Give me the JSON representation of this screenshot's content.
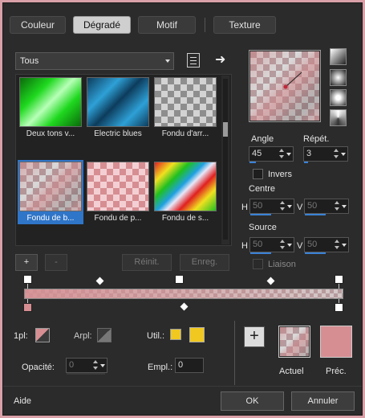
{
  "tabs": [
    {
      "label": "Couleur"
    },
    {
      "label": "Dégradé"
    },
    {
      "label": "Motif"
    },
    {
      "label": "Texture"
    }
  ],
  "category": {
    "selected": "Tous"
  },
  "gradients": [
    {
      "caption": "Deux tons v..."
    },
    {
      "caption": "Electric blues"
    },
    {
      "caption": "Fondu d'arr..."
    },
    {
      "caption": "Fondu de b..."
    },
    {
      "caption": "Fondu de p..."
    },
    {
      "caption": "Fondu de s..."
    }
  ],
  "selected_gradient_index": 3,
  "library_buttons": {
    "add": "+",
    "remove": "-",
    "reset": "Réinit.",
    "save": "Enreg."
  },
  "angle": {
    "label": "Angle",
    "value": "45"
  },
  "repeat": {
    "label": "Répét.",
    "value": "3"
  },
  "invert": {
    "label": "Invers",
    "checked": false
  },
  "center": {
    "label": "Centre",
    "h_label": "H",
    "h_value": "50",
    "v_label": "V",
    "v_value": "50"
  },
  "source": {
    "label": "Source",
    "h_label": "H",
    "h_value": "50",
    "v_label": "V",
    "v_value": "50"
  },
  "link": {
    "label": "Liaison",
    "checked": false
  },
  "stops": {
    "first_label": "1pl:",
    "bg_label": "Arpl:",
    "user_label": "Util.:",
    "user_color": "#f0c820",
    "opacity_label": "Opacité:",
    "opacity_value": "0",
    "location_label": "Empl.:",
    "location_value": "0"
  },
  "preview": {
    "current_label": "Actuel",
    "previous_label": "Préc."
  },
  "colors": {
    "pink": "#d68e92",
    "accent": "#2f75c8"
  },
  "footer": {
    "help": "Aide",
    "ok": "OK",
    "cancel": "Annuler"
  }
}
